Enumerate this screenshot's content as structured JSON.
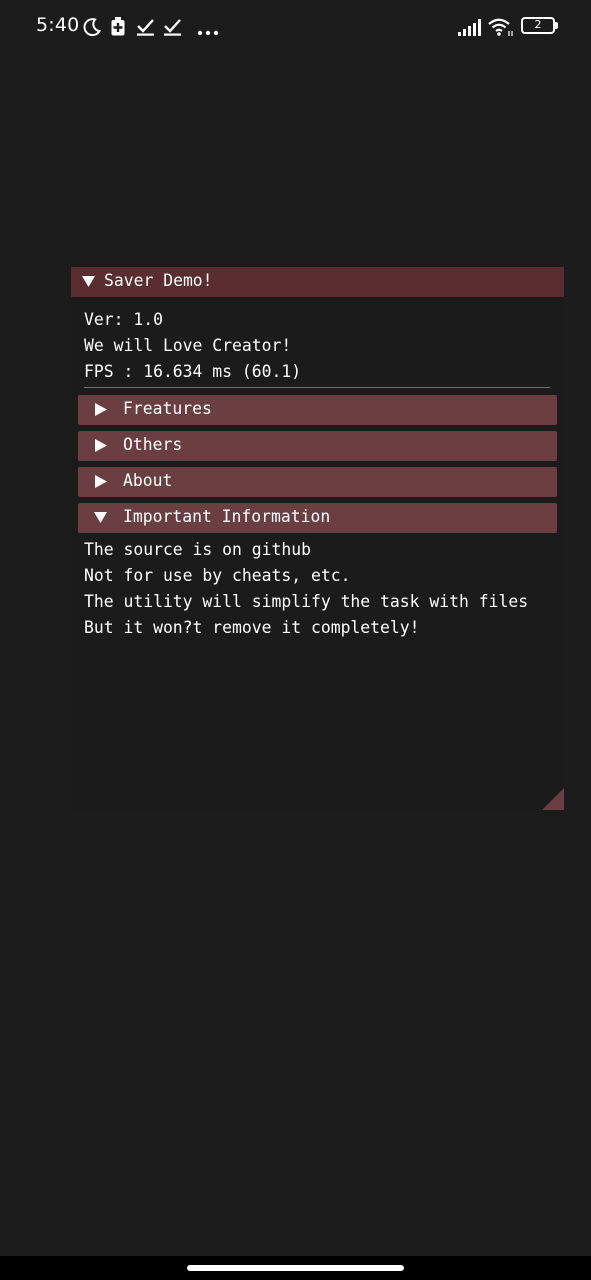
{
  "status_bar": {
    "time": "5:40",
    "battery_level": "2"
  },
  "window": {
    "title": "Saver Demo!",
    "lines": [
      "Ver: 1.0",
      "We will Love Creator!",
      "FPS : 16.634 ms (60.1)"
    ],
    "headers": [
      {
        "label": "Freatures",
        "expanded": false
      },
      {
        "label": "Others",
        "expanded": false
      },
      {
        "label": "About",
        "expanded": false
      },
      {
        "label": "Important Information",
        "expanded": true
      }
    ],
    "info_lines": [
      "The source is on github",
      "Not for use by cheats, etc.",
      "The utility will simplify the task with files",
      "But it won?t remove it completely!"
    ]
  },
  "colors": {
    "background": "#1c1c1c",
    "title_bar": "#5a2d30",
    "header": "#6b3f41",
    "window_bg": "#1b1b1b",
    "text": "#ffffff"
  }
}
